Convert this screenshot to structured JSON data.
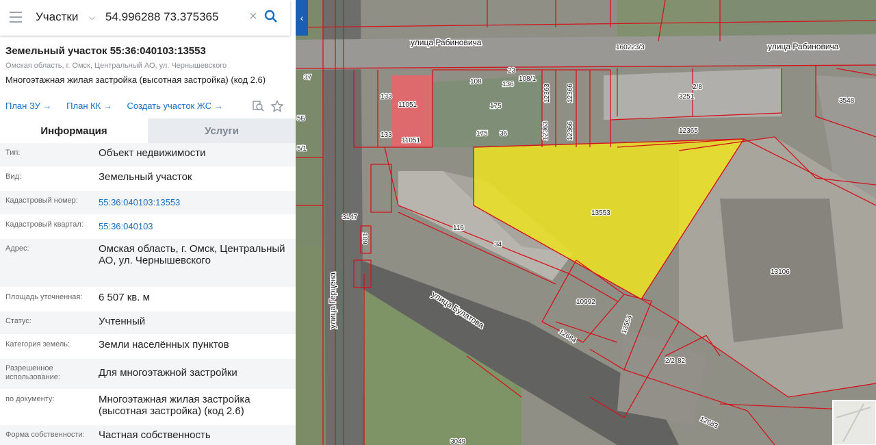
{
  "search": {
    "layer_label": "Участки",
    "query": "54.996288 73.375365"
  },
  "parcel": {
    "title": "Земельный участок 55:36:040103:13553",
    "address_short": "Омская область, г. Омск, Центральный АО, ул. Чернышевского",
    "use_text": "Многоэтажная жилая застройка (высотная застройка) (код 2.6)",
    "links": [
      "План ЗУ →",
      "План КК →",
      "Создать участок ЖС →"
    ]
  },
  "tabs": [
    "Информация",
    "Услуги"
  ],
  "info_rows": [
    {
      "label": "Тип:",
      "value": "Объект недвижимости"
    },
    {
      "label": "Вид:",
      "value": "Земельный участок"
    },
    {
      "label": "Кадастровый номер:",
      "value": "55:36:040103:13553"
    },
    {
      "label": "Кадастровый квартал:",
      "value": "55:36:040103"
    },
    {
      "label": "Адрес:",
      "value": "Омская область, г. Омск, Центральный АО, ул. Чернышевского"
    },
    {
      "label": "Площадь уточненная:",
      "value": "6 507 кв. м"
    },
    {
      "label": "Статус:",
      "value": "Учтенный"
    },
    {
      "label": "Категория земель:",
      "value": "Земли населённых пунктов"
    },
    {
      "label": "Разрешенное использование:",
      "value": "Для многоэтажной застройки"
    },
    {
      "label": "по документу:",
      "value": "Многоэтажная жилая застройка (высотная застройка) (код 2.6)"
    },
    {
      "label": "Форма собственности:",
      "value": "Частная собственность"
    }
  ],
  "map": {
    "streets": [
      "улица Рабиновича",
      "улица Рабиновича",
      "улица Герцена",
      "улица Булатова"
    ],
    "parcel_numbers": [
      "160223/3",
      "23",
      "108",
      "136",
      "108/1",
      "12363",
      "12366",
      "2/8",
      "3251",
      "3548",
      "133",
      "11051",
      "133",
      "11051",
      "175",
      "175",
      "36",
      "12363",
      "12366",
      "12365",
      "37",
      "5Б",
      "5/1",
      "13553",
      "116",
      "34",
      "3147",
      "109",
      "13106",
      "10992",
      "12684",
      "13554",
      "2/2",
      "82",
      "12683",
      "3049"
    ],
    "selected_color": "#f2e51d",
    "highlight_color": "#e8666b",
    "boundary_color": "#d4131b"
  },
  "icons": [
    "menu-icon",
    "chevron-down-icon",
    "clear-icon",
    "search-icon",
    "collapse-left-icon",
    "zoom-find-icon",
    "star-icon"
  ]
}
